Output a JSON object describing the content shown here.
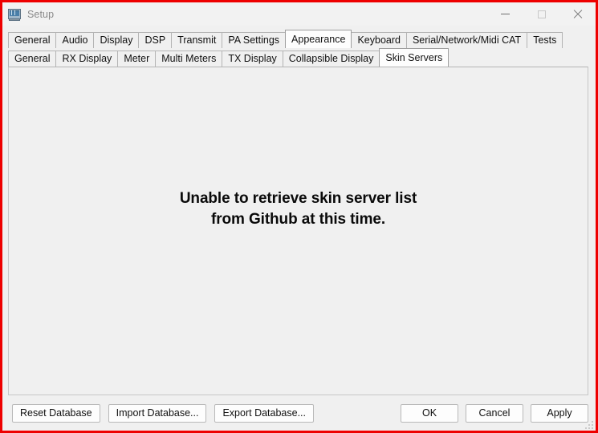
{
  "window": {
    "title": "Setup",
    "icon": "application-icon",
    "accent_border_color": "#ee0000",
    "background_color": "#f0f0f0",
    "controls": [
      {
        "name": "minimize-button",
        "glyph": "minimize-icon",
        "label": "Minimize"
      },
      {
        "name": "maximize-button",
        "glyph": "maximize-icon",
        "label": "Maximize"
      },
      {
        "name": "close-button",
        "glyph": "close-icon",
        "label": "Close"
      }
    ]
  },
  "tabs_primary": {
    "selected": "Appearance",
    "items": [
      {
        "label": "General"
      },
      {
        "label": "Audio"
      },
      {
        "label": "Display"
      },
      {
        "label": "DSP"
      },
      {
        "label": "Transmit"
      },
      {
        "label": "PA Settings"
      },
      {
        "label": "Appearance"
      },
      {
        "label": "Keyboard"
      },
      {
        "label": "Serial/Network/Midi CAT"
      },
      {
        "label": "Tests"
      }
    ]
  },
  "tabs_secondary": {
    "selected": "Skin Servers",
    "items": [
      {
        "label": "General"
      },
      {
        "label": "RX Display"
      },
      {
        "label": "Meter"
      },
      {
        "label": "Multi Meters"
      },
      {
        "label": "TX Display"
      },
      {
        "label": "Collapsible Display"
      },
      {
        "label": "Skin Servers"
      }
    ]
  },
  "content": {
    "message_line1": "Unable to retrieve skin server list",
    "message_line2": "from Github at this time."
  },
  "buttons": {
    "left": [
      {
        "label": "Reset Database",
        "name": "reset-database-button"
      },
      {
        "label": "Import Database...",
        "name": "import-database-button"
      },
      {
        "label": "Export Database...",
        "name": "export-database-button"
      }
    ],
    "right": [
      {
        "label": "OK",
        "name": "ok-button"
      },
      {
        "label": "Cancel",
        "name": "cancel-button"
      },
      {
        "label": "Apply",
        "name": "apply-button"
      }
    ]
  }
}
